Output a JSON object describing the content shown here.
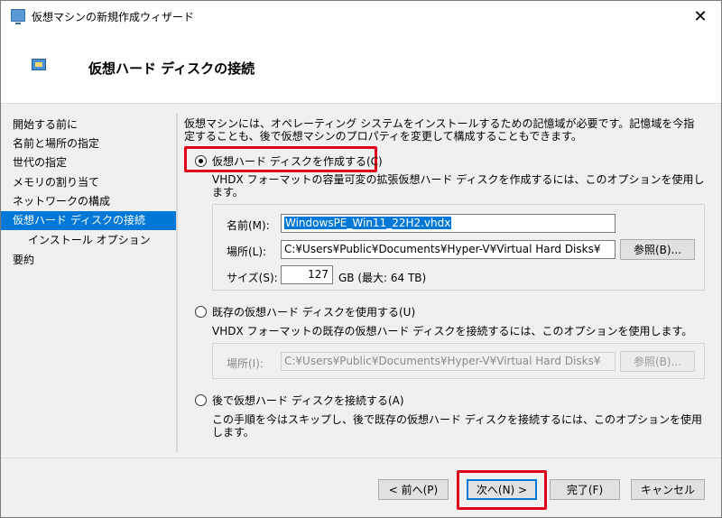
{
  "window": {
    "title": "仮想マシンの新規作成ウィザード",
    "close_glyph": "✕"
  },
  "header": {
    "title": "仮想ハード ディスクの接続"
  },
  "sidebar": {
    "items": [
      {
        "label": "開始する前に"
      },
      {
        "label": "名前と場所の指定"
      },
      {
        "label": "世代の指定"
      },
      {
        "label": "メモリの割り当て"
      },
      {
        "label": "ネットワークの構成"
      },
      {
        "label": "仮想ハード ディスクの接続"
      },
      {
        "label": "インストール オプション"
      },
      {
        "label": "要約"
      }
    ]
  },
  "main": {
    "intro": "仮想マシンには、オペレーティング システムをインストールするための記憶域が必要です。記憶域を今指定することも、後で仮想マシンのプロパティを変更して構成することもできます。",
    "option_create": {
      "label": "仮想ハード ディスクを作成する(C)",
      "description": "VHDX フォーマットの容量可変の拡張仮想ハード ディスクを作成するには、このオプションを使用します。",
      "name_label": "名前(M):",
      "name_value": "WindowsPE_Win11_22H2.vhdx",
      "location_label": "場所(L):",
      "location_value": "C:¥Users¥Public¥Documents¥Hyper-V¥Virtual Hard Disks¥",
      "browse_label": "参照(B)...",
      "size_label": "サイズ(S):",
      "size_value": "127",
      "size_unit": "GB (最大: 64 TB)"
    },
    "option_existing": {
      "label": "既存の仮想ハード ディスクを使用する(U)",
      "description": "VHDX フォーマットの既存の仮想ハード ディスクを接続するには、このオプションを使用します。",
      "location_label": "場所(I):",
      "location_value": "C:¥Users¥Public¥Documents¥Hyper-V¥Virtual Hard Disks¥",
      "browse_label": "参照(B)..."
    },
    "option_later": {
      "label": "後で仮想ハード ディスクを接続する(A)",
      "description": "この手順を今はスキップし、後で既存の仮想ハード ディスクを接続するには、このオプションを使用します。"
    }
  },
  "footer": {
    "prev_label": "< 前へ(P)",
    "next_label": "次へ(N) >",
    "finish_label": "完了(F)",
    "cancel_label": "キャンセル"
  },
  "colors": {
    "accent": "#0078d7",
    "highlight": "#e0001a"
  }
}
